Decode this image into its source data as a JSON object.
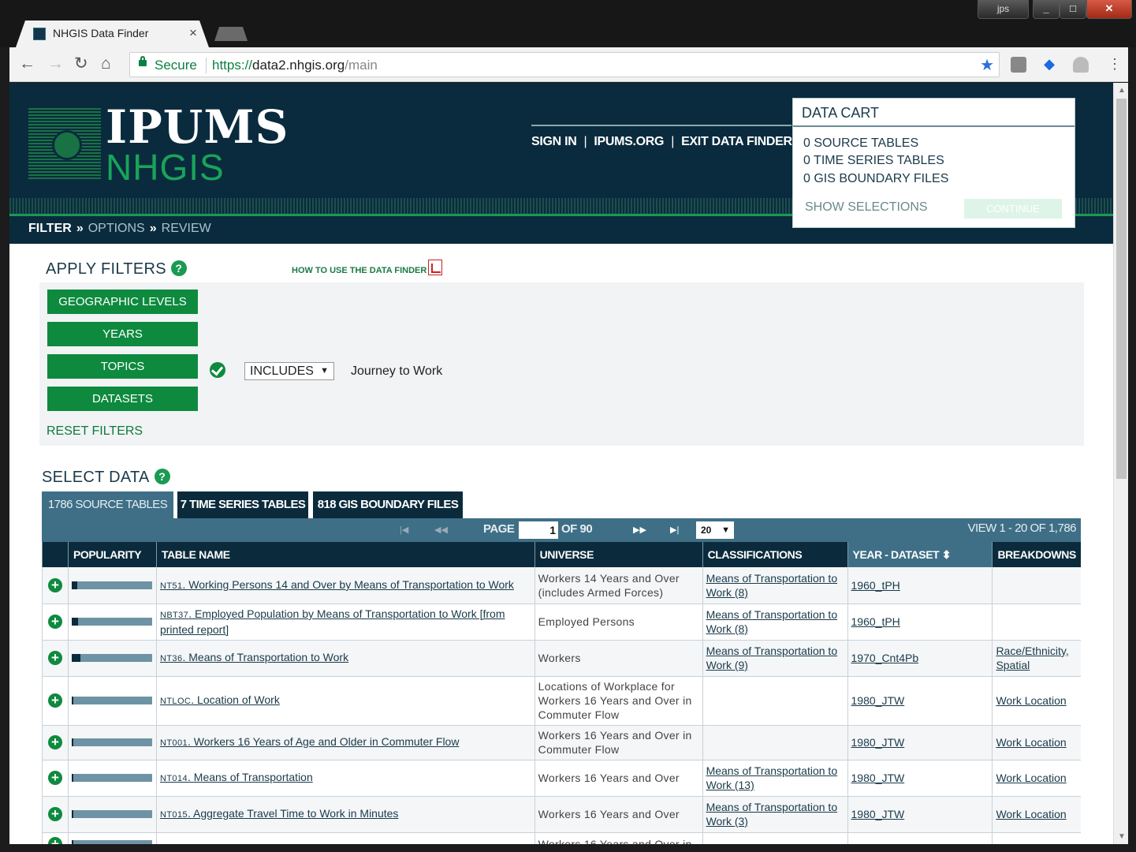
{
  "browser": {
    "tab_title": "NHGIS Data Finder",
    "tab_close": "×",
    "user_badge": "jps",
    "url_secure": "Secure",
    "url_proto": "https://",
    "url_host": "data2.nhgis.org",
    "url_path": "/main"
  },
  "header": {
    "logo_top": "IPUMS",
    "logo_bottom": "NHGIS",
    "links": [
      "SIGN IN",
      "IPUMS.ORG",
      "EXIT DATA FINDER"
    ],
    "breadcrumb": [
      "FILTER",
      "OPTIONS",
      "REVIEW"
    ]
  },
  "cart": {
    "title": "DATA CART",
    "lines": [
      "0  SOURCE TABLES",
      "0  TIME SERIES TABLES",
      "0  GIS BOUNDARY FILES"
    ],
    "show": "SHOW SELECTIONS",
    "continue": "CONTINUE"
  },
  "filters": {
    "title": "APPLY FILTERS",
    "help": "?",
    "howto": "HOW TO USE THE DATA FINDER",
    "buttons": [
      "GEOGRAPHIC LEVELS",
      "YEARS",
      "TOPICS",
      "DATASETS"
    ],
    "reset": "RESET FILTERS",
    "topic_mode": "INCLUDES",
    "topic_value": "Journey to Work"
  },
  "select": {
    "title": "SELECT DATA",
    "help": "?",
    "tabs": [
      "1786 SOURCE TABLES",
      "7 TIME SERIES TABLES",
      "818 GIS BOUNDARY FILES"
    ],
    "page_label": "PAGE",
    "page_value": "1",
    "page_of": "OF 90",
    "per_page": "20",
    "view_range": "VIEW 1 - 20 OF 1,786",
    "columns": [
      "POPULARITY",
      "TABLE NAME",
      "UNIVERSE",
      "CLASSIFICATIONS",
      "YEAR - DATASET",
      "BREAKDOWNS"
    ],
    "sort_glyph": "⬍"
  },
  "rows": [
    {
      "pop": 0.07,
      "code": "NT51",
      "name": "Working Persons 14 and Over by Means of Transportation to Work",
      "universe": "Workers 14 Years and Over (includes Armed Forces)",
      "class": "Means of Transportation to Work (8)",
      "dataset": "1960_tPH",
      "breakdown": ""
    },
    {
      "pop": 0.08,
      "code": "NBT37",
      "name": "Employed Population by Means of Transportation to Work [from printed report]",
      "universe": "Employed Persons",
      "class": "Means of Transportation to Work (8)",
      "dataset": "1960_tPH",
      "breakdown": ""
    },
    {
      "pop": 0.11,
      "code": "NT36",
      "name": "Means of Transportation to Work",
      "universe": "Workers",
      "class": "Means of Transportation to Work (9)",
      "dataset": "1970_Cnt4Pb",
      "breakdown": "Race/Ethnicity, Spatial"
    },
    {
      "pop": 0.02,
      "code": "NTLOC",
      "name": "Location of Work",
      "universe": "Locations of Workplace for Workers 16 Years and Over in Commuter Flow",
      "class": "",
      "dataset": "1980_JTW",
      "breakdown": "Work Location"
    },
    {
      "pop": 0.02,
      "code": "NT001",
      "name": "Workers 16 Years of Age and Older in Commuter Flow",
      "universe": "Workers 16 Years and Over in Commuter Flow",
      "class": "",
      "dataset": "1980_JTW",
      "breakdown": "Work Location"
    },
    {
      "pop": 0.02,
      "code": "NT014",
      "name": "Means of Transportation",
      "universe": "Workers 16 Years and Over",
      "class": "Means of Transportation to Work (13)",
      "dataset": "1980_JTW",
      "breakdown": "Work Location"
    },
    {
      "pop": 0.02,
      "code": "NT015",
      "name": "Aggregate Travel Time to Work in Minutes",
      "universe": "Workers 16 Years and Over",
      "class": "Means of Transportation to Work (3)",
      "dataset": "1980_JTW",
      "breakdown": "Work Location"
    },
    {
      "pop": 0.02,
      "code": "",
      "name": "",
      "universe": "Workers 16 Years and Over in",
      "class": "",
      "dataset": "",
      "breakdown": ""
    }
  ]
}
